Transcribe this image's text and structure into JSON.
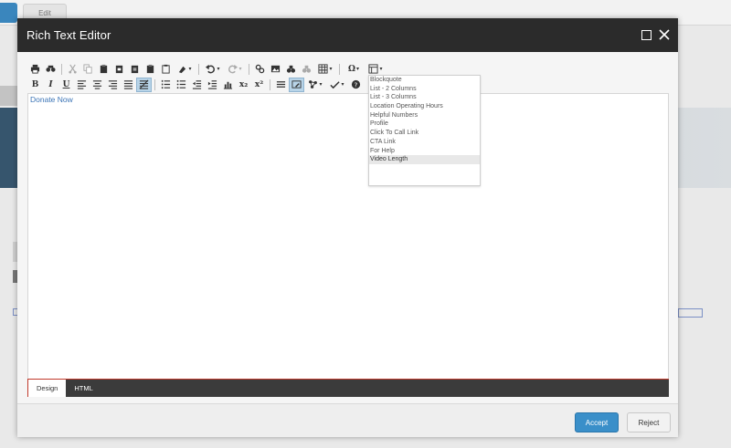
{
  "background": {
    "edit_tab_label": "Edit"
  },
  "modal": {
    "title": "Rich Text Editor",
    "editor_content": {
      "link_text": "Donate Now"
    },
    "mode_tabs": [
      {
        "label": "Design",
        "active": true
      },
      {
        "label": "HTML",
        "active": false
      }
    ],
    "buttons": {
      "accept": "Accept",
      "reject": "Reject"
    }
  },
  "style_dropdown": {
    "items": [
      "Blockquote",
      "List - 2 Columns",
      "List - 3 Columns",
      "Location Operating Hours",
      "Helpful Numbers",
      "Profile",
      "Click To Call Link",
      "CTA Link",
      "For Help",
      "Video Length"
    ],
    "highlighted_item": "Video Length"
  },
  "toolbar": {
    "row1": [
      "print-icon",
      "find-icon",
      "cut-icon",
      "copy-icon",
      "paste-icon",
      "paste-word-icon",
      "paste-text-icon",
      "paste-html-icon",
      "paste-as-icon",
      "format-stripper-icon",
      "undo-icon",
      "redo-icon",
      "link-manager-icon",
      "image-manager-icon",
      "hyperlink-icon",
      "unlink-icon",
      "table-icon",
      "symbol-icon",
      "template-icon"
    ],
    "row2_text": {
      "bold": "B",
      "italic": "I",
      "underline": "U",
      "subscript": "x₂",
      "superscript": "x²",
      "omega": "Ω"
    }
  },
  "colors": {
    "header_bg": "#2b2b2b",
    "accent_blue": "#3a8fc9",
    "tab_border": "#c0392b",
    "link": "#3b74b6"
  }
}
